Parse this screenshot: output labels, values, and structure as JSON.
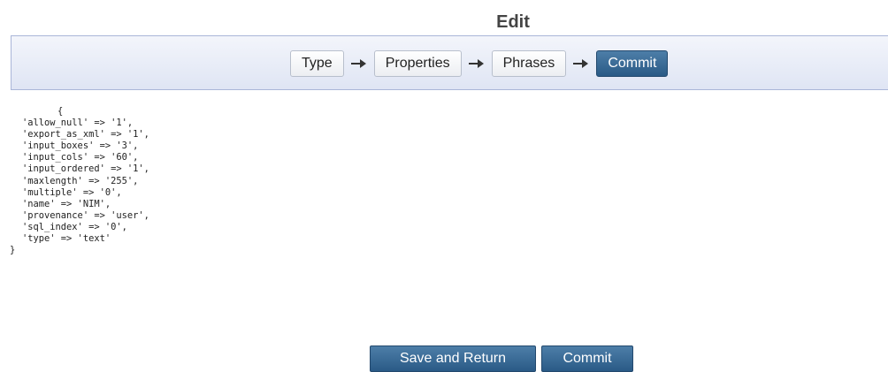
{
  "page": {
    "title": "Edit"
  },
  "wizard": {
    "steps": [
      {
        "label": "Type",
        "active": false
      },
      {
        "label": "Properties",
        "active": false
      },
      {
        "label": "Phrases",
        "active": false
      },
      {
        "label": "Commit",
        "active": true
      }
    ],
    "separator_icon": "arrow-right-icon"
  },
  "code": {
    "open_brace": "{",
    "lines": [
      "'allow_null' => '1',",
      "'export_as_xml' => '1',",
      "'input_boxes' => '3',",
      "'input_cols' => '60',",
      "'input_ordered' => '1',",
      "'maxlength' => '255',",
      "'multiple' => '0',",
      "'name' => 'NIM',",
      "'provenance' => 'user',",
      "'sql_index' => '0',",
      "'type' => 'text'"
    ],
    "close_brace": "}"
  },
  "actions": {
    "save_and_return_label": "Save and Return",
    "commit_label": "Commit"
  },
  "colors": {
    "active_button": "#2f6190",
    "bar_border": "#aab6d8",
    "bar_background": "#e6eaf6"
  }
}
